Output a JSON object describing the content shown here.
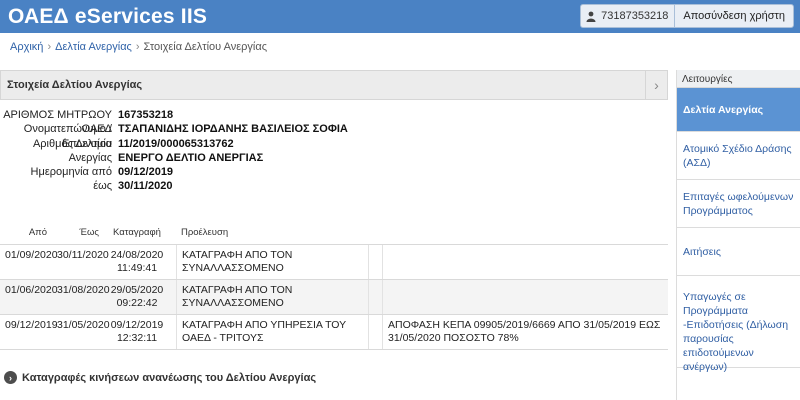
{
  "header": {
    "title": "ΟΑΕΔ eServices IIS",
    "user_id": "73187353218",
    "logout_label": "Αποσύνδεση χρήστη",
    "user_icon": "user-icon"
  },
  "breadcrumb": {
    "items": [
      "Αρχική",
      "Δελτία Ανεργίας",
      "Στοιχεία Δελτίου Ανεργίας"
    ]
  },
  "panel": {
    "title": "Στοιχεία Δελτίου Ανεργίας",
    "collapse_icon": "chevron-right-icon"
  },
  "details": {
    "registry_label": "ΑΡΙΘΜΟΣ ΜΗΤΡΩΟΥ ΟΑΕΔ",
    "registry_value": "167353218",
    "name_label": "Ονοματεπώνυμο / Επωνυμία",
    "name_value": "ΤΣΑΠΑΝΙΔΗΣ ΙΟΡΔΑΝΗΣ ΒΑΣΙΛΕΙΟΣ ΣΟΦΙΑ",
    "card_label": "Αριθμός Δελτίου Ανεργίας",
    "card_value": "11/2019/000065313762",
    "status_value": "ΕΝΕΡΓΟ ΔΕΛΤΙΟ ΑΝΕΡΓΙΑΣ",
    "from_label": "Ημερομηνία από",
    "from_value": "09/12/2019",
    "to_label": "έως",
    "to_value": "30/11/2020"
  },
  "table": {
    "headers": [
      "Από",
      "Έως",
      "Καταγραφή",
      "Προέλευση"
    ],
    "rows": [
      {
        "from": "01/09/2020",
        "to": "30/11/2020",
        "recorded_date": "24/08/2020",
        "recorded_time": "11:49:41",
        "origin": "ΚΑΤΑΓΡΑΦΗ ΑΠΟ ΤΟΝ ΣΥΝΑΛΛΑΣΣΟΜΕΝΟ",
        "note": ""
      },
      {
        "from": "01/06/2020",
        "to": "31/08/2020",
        "recorded_date": "29/05/2020",
        "recorded_time": "09:22:42",
        "origin": "ΚΑΤΑΓΡΑΦΗ ΑΠΟ ΤΟΝ ΣΥΝΑΛΛΑΣΣΟΜΕΝΟ",
        "note": ""
      },
      {
        "from": "09/12/2019",
        "to": "31/05/2020",
        "recorded_date": "09/12/2019",
        "recorded_time": "12:32:11",
        "origin": "ΚΑΤΑΓΡΑΦΗ ΑΠΟ ΥΠΗΡΕΣΙΑ ΤΟΥ ΟΑΕΔ - ΤΡΙΤΟΥΣ",
        "note": "ΑΠΟΦΑΣΗ ΚΕΠΑ 09905/2019/6669 ΑΠΟ 31/05/2019 ΕΩΣ 31/05/2020 ΠΟΣΟΣΤΟ 78%"
      }
    ]
  },
  "movements_link": "Καταγραφές κινήσεων ανανέωσης του Δελτίου Ανεργίας",
  "sidebar": {
    "title": "Λειτουργίες",
    "items": [
      {
        "label": "Δελτία Ανεργίας",
        "active": true
      },
      {
        "label": "Ατομικό Σχέδιο Δράσης (ΑΣΔ)",
        "active": false
      },
      {
        "label": "Επιταγές ωφελούμενων Προγράμματος",
        "active": false
      },
      {
        "label": "Αιτήσεις",
        "active": false
      },
      {
        "label": "Υπαγωγές σε Προγράμματα -Επιδοτήσεις (Δήλωση παρουσίας επιδοτούμενων ανέργων)",
        "active": false
      }
    ]
  },
  "colors": {
    "topbar": "#4a82c4",
    "sidebar_active": "#5b93d3",
    "link": "#2f62a8"
  }
}
